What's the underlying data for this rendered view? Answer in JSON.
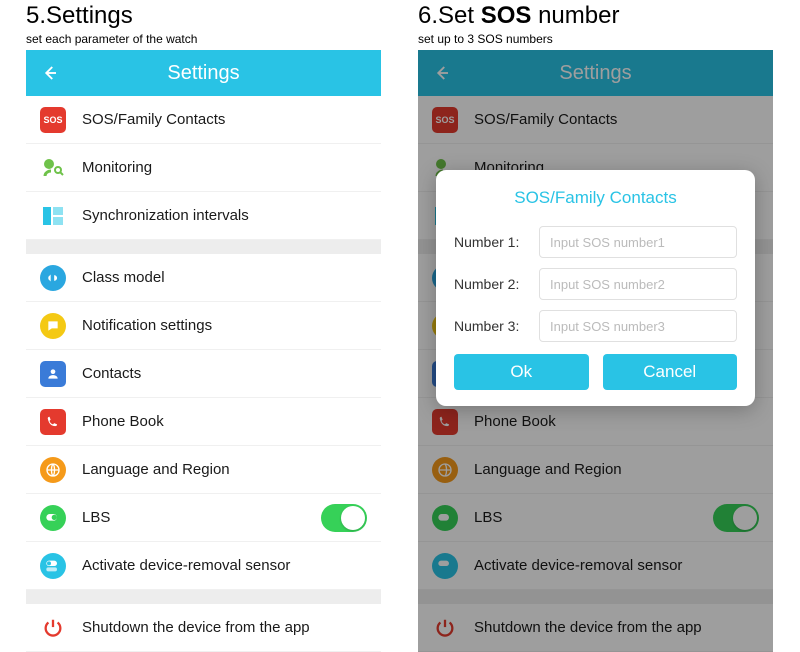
{
  "left": {
    "heading": "5.Settings",
    "subheading": "set each parameter of the watch",
    "header_title": "Settings",
    "groups": [
      [
        {
          "label": "SOS/Family Contacts",
          "icon": "sos-icon"
        },
        {
          "label": "Monitoring",
          "icon": "monitoring-icon"
        },
        {
          "label": "Synchronization intervals",
          "icon": "sync-intervals-icon"
        }
      ],
      [
        {
          "label": "Class model",
          "icon": "class-model-icon"
        },
        {
          "label": "Notification settings",
          "icon": "notification-icon"
        },
        {
          "label": "Contacts",
          "icon": "contacts-icon"
        },
        {
          "label": "Phone Book",
          "icon": "phone-book-icon"
        },
        {
          "label": "Language and Region",
          "icon": "language-icon"
        },
        {
          "label": "LBS",
          "icon": "lbs-icon",
          "toggle": true
        },
        {
          "label": "Activate device-removal sensor",
          "icon": "removal-sensor-icon"
        }
      ],
      [
        {
          "label": "Shutdown the device from the app",
          "icon": "shutdown-icon"
        }
      ]
    ]
  },
  "right": {
    "heading_prefix": "6.Set ",
    "heading_bold": "SOS",
    "heading_suffix": " number",
    "subheading": "set up to 3 SOS numbers",
    "header_title": "Settings",
    "modal": {
      "title": "SOS/Family Contacts",
      "fields": [
        {
          "label": "Number 1:",
          "placeholder": "Input SOS number1"
        },
        {
          "label": "Number 2:",
          "placeholder": "Input SOS number2"
        },
        {
          "label": "Number 3:",
          "placeholder": "Input SOS number3"
        }
      ],
      "ok": "Ok",
      "cancel": "Cancel"
    }
  },
  "colors": {
    "accent": "#29c3e5",
    "toggle_on": "#36d158"
  }
}
